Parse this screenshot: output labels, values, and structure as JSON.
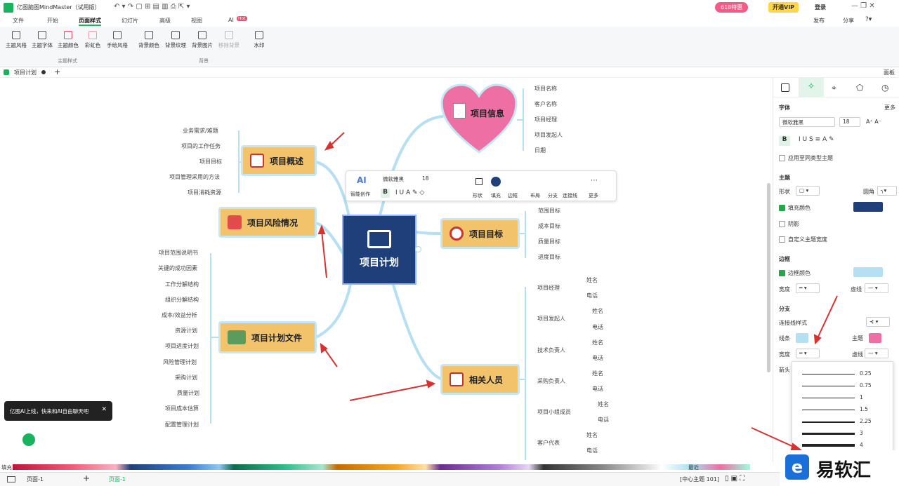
{
  "app": {
    "title": "亿图脑图MindMaster（试用版）",
    "promo": "618特惠",
    "vip": "开通VIP",
    "login": "登录"
  },
  "tabs": [
    "文件",
    "开始",
    "页面样式",
    "幻灯片",
    "高级",
    "视图",
    "AI"
  ],
  "tab_ai_badge": "Hot",
  "top_actions": [
    "发布",
    "分享"
  ],
  "ribbon": {
    "group1": [
      "主题风格",
      "主题字体",
      "主题颜色",
      "彩虹色",
      "手绘风格"
    ],
    "group1_label": "主题样式",
    "group2": [
      "背景颜色",
      "背景纹理",
      "背景图片",
      "移除背景"
    ],
    "group2_label": "背景",
    "group3": [
      "水印"
    ]
  },
  "doctab": "项目计划",
  "panel_toggle": "面板",
  "central": "项目计划",
  "topics": {
    "info": "项目信息",
    "overview": "项目概述",
    "risk": "项目风险情况",
    "goal": "项目目标",
    "docs": "项目计划文件",
    "people": "相关人员"
  },
  "info_leaves": [
    "项目名称",
    "客户名称",
    "项目经理",
    "项目发起人",
    "日期"
  ],
  "overview_leaves": [
    "业务需求/难题",
    "项目的工作任务",
    "项目目标",
    "项目管理采用的方法",
    "项目消耗资源"
  ],
  "goal_leaves": [
    "范围目标",
    "成本目标",
    "质量目标",
    "进度目标"
  ],
  "docs_leaves": [
    "项目范围说明书",
    "关键的成功因素",
    "工作分解结构",
    "组织分解结构",
    "成本/效益分析",
    "资源计划",
    "项目进度计划",
    "风险管理计划",
    "采购计划",
    "质量计划",
    "项目成本估算",
    "配置管理计划"
  ],
  "people_groups": [
    {
      "role": "项目经理",
      "a": "姓名",
      "b": "电话"
    },
    {
      "role": "项目发起人",
      "a": "姓名",
      "b": "电话"
    },
    {
      "role": "技术负责人",
      "a": "姓名",
      "b": "电话"
    },
    {
      "role": "采购负责人",
      "a": "姓名",
      "b": "电话"
    },
    {
      "role": "项目小组成员",
      "a": "姓名",
      "b": "电话"
    },
    {
      "role": "客户代表",
      "a": "姓名",
      "b": "电话"
    }
  ],
  "float": {
    "ai": "智能创作",
    "font": "微软雅黑",
    "size": "18",
    "items": [
      "形状",
      "填充",
      "边框",
      "布局",
      "分支",
      "连接线",
      "更多"
    ]
  },
  "panel": {
    "font_title": "字体",
    "more": "更多",
    "font": "微软雅黑",
    "size": "18",
    "apply": "应用至同类型主题",
    "theme": "主题",
    "shape": "形状",
    "corner": "圆角",
    "fill": "填充颜色",
    "shadow": "阴影",
    "custom_width": "自定义主题宽度",
    "border": "边框",
    "border_color": "边框颜色",
    "width": "宽度",
    "dash": "虚线",
    "branch": "分支",
    "conn_style": "连接线样式",
    "line": "线条",
    "theme2": "主题",
    "width2": "宽度",
    "dash2": "虚线",
    "arrow": "箭头"
  },
  "widths": [
    "0.25",
    "0.75",
    "1",
    "1.5",
    "2.25",
    "3",
    "4"
  ],
  "tooltip": "亿图AI上线，快来和AI自由聊天吧",
  "status": {
    "fill": "填充",
    "page": "页面-1",
    "page_tab": "页面-1",
    "recent": "最近",
    "info": "[中心主题 101]"
  },
  "watermark": "易软汇",
  "colors": {
    "central": "#1f3f7a",
    "topic": "#f2c36a",
    "branch": "#b5dff2",
    "heart": "#ee6fa4"
  }
}
